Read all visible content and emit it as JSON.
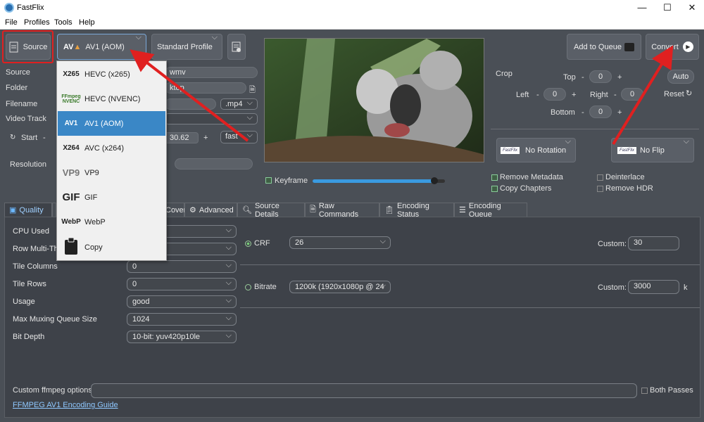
{
  "window": {
    "title": "FastFlix",
    "min": "—",
    "max": "☐",
    "close": "✕"
  },
  "menu": [
    "File",
    "Profiles",
    "Tools",
    "Help"
  ],
  "toolbar": {
    "source_label": "Source",
    "encoder_selected": "AV1 (AOM)",
    "profile": "Standard Profile",
    "add_to_queue": "Add to Queue",
    "convert": "Convert"
  },
  "source_panel": {
    "source_label": "Source",
    "source_value": "wmv",
    "folder_label": "Folder",
    "folder_value": "ktop",
    "filename_label": "Filename",
    "ext": ".mp4",
    "video_track_label": "Video Track",
    "start_label": "Start",
    "start_minus": "-",
    "end_value": "30.62",
    "end_plus": "+",
    "seek_mode": "fast",
    "resolution_label": "Resolution"
  },
  "encoder_dropdown": [
    {
      "icon": "X265",
      "label": "HEVC (x265)"
    },
    {
      "icon": "FFmpeg NVENC",
      "label": "HEVC (NVENC)"
    },
    {
      "icon": "AV1",
      "label": "AV1 (AOM)"
    },
    {
      "icon": "X264",
      "label": "AVC (x264)"
    },
    {
      "icon": "VP9",
      "label": "VP9"
    },
    {
      "icon": "GIF",
      "label": "GIF"
    },
    {
      "icon": "WebP",
      "label": "WebP"
    },
    {
      "icon": "clipboard",
      "label": "Copy"
    }
  ],
  "preview": {
    "keyframe_label": "Keyframe",
    "slider_fraction": 0.92
  },
  "crop": {
    "label": "Crop",
    "top_label": "Top",
    "top": "0",
    "left_label": "Left",
    "left": "0",
    "right_label": "Right",
    "right": "0",
    "bottom_label": "Bottom",
    "bottom": "0",
    "auto": "Auto",
    "reset": "Reset",
    "minus": "-",
    "plus": "+"
  },
  "transform": {
    "rotation": "No Rotation",
    "flip": "No Flip",
    "logo_text": "FastFlix"
  },
  "options": {
    "remove_metadata": "Remove Metadata",
    "copy_chapters": "Copy Chapters",
    "deinterlace": "Deinterlace",
    "remove_hdr": "Remove HDR"
  },
  "tabs": [
    "Quality",
    "Cover",
    "Advanced",
    "Source Details",
    "Raw Commands",
    "Encoding Status",
    "Encoding Queue"
  ],
  "quality": {
    "fields": [
      {
        "label": "CPU Used",
        "value": ""
      },
      {
        "label": "Row Multi-Thr",
        "value": ""
      },
      {
        "label": "Tile Columns",
        "value": "0"
      },
      {
        "label": "Tile Rows",
        "value": "0"
      },
      {
        "label": "Usage",
        "value": "good"
      },
      {
        "label": "Max Muxing Queue Size",
        "value": "1024"
      },
      {
        "label": "Bit Depth",
        "value": "10-bit: yuv420p10le"
      }
    ],
    "crf_label": "CRF",
    "crf_value": "26",
    "crf_custom_label": "Custom:",
    "crf_custom_value": "30",
    "bitrate_label": "Bitrate",
    "bitrate_value": "1200k (1920x1080p @ 24",
    "bitrate_custom_label": "Custom:",
    "bitrate_custom_value": "3000",
    "bitrate_unit": "k"
  },
  "footer": {
    "custom_ffmpeg_label": "Custom ffmpeg options",
    "both_passes": "Both Passes",
    "guide_link": "FFMPEG AV1 Encoding Guide"
  },
  "colors": {
    "accent": "#3a87c6",
    "annotation_red": "#e02020",
    "link": "#8fc8ff"
  }
}
